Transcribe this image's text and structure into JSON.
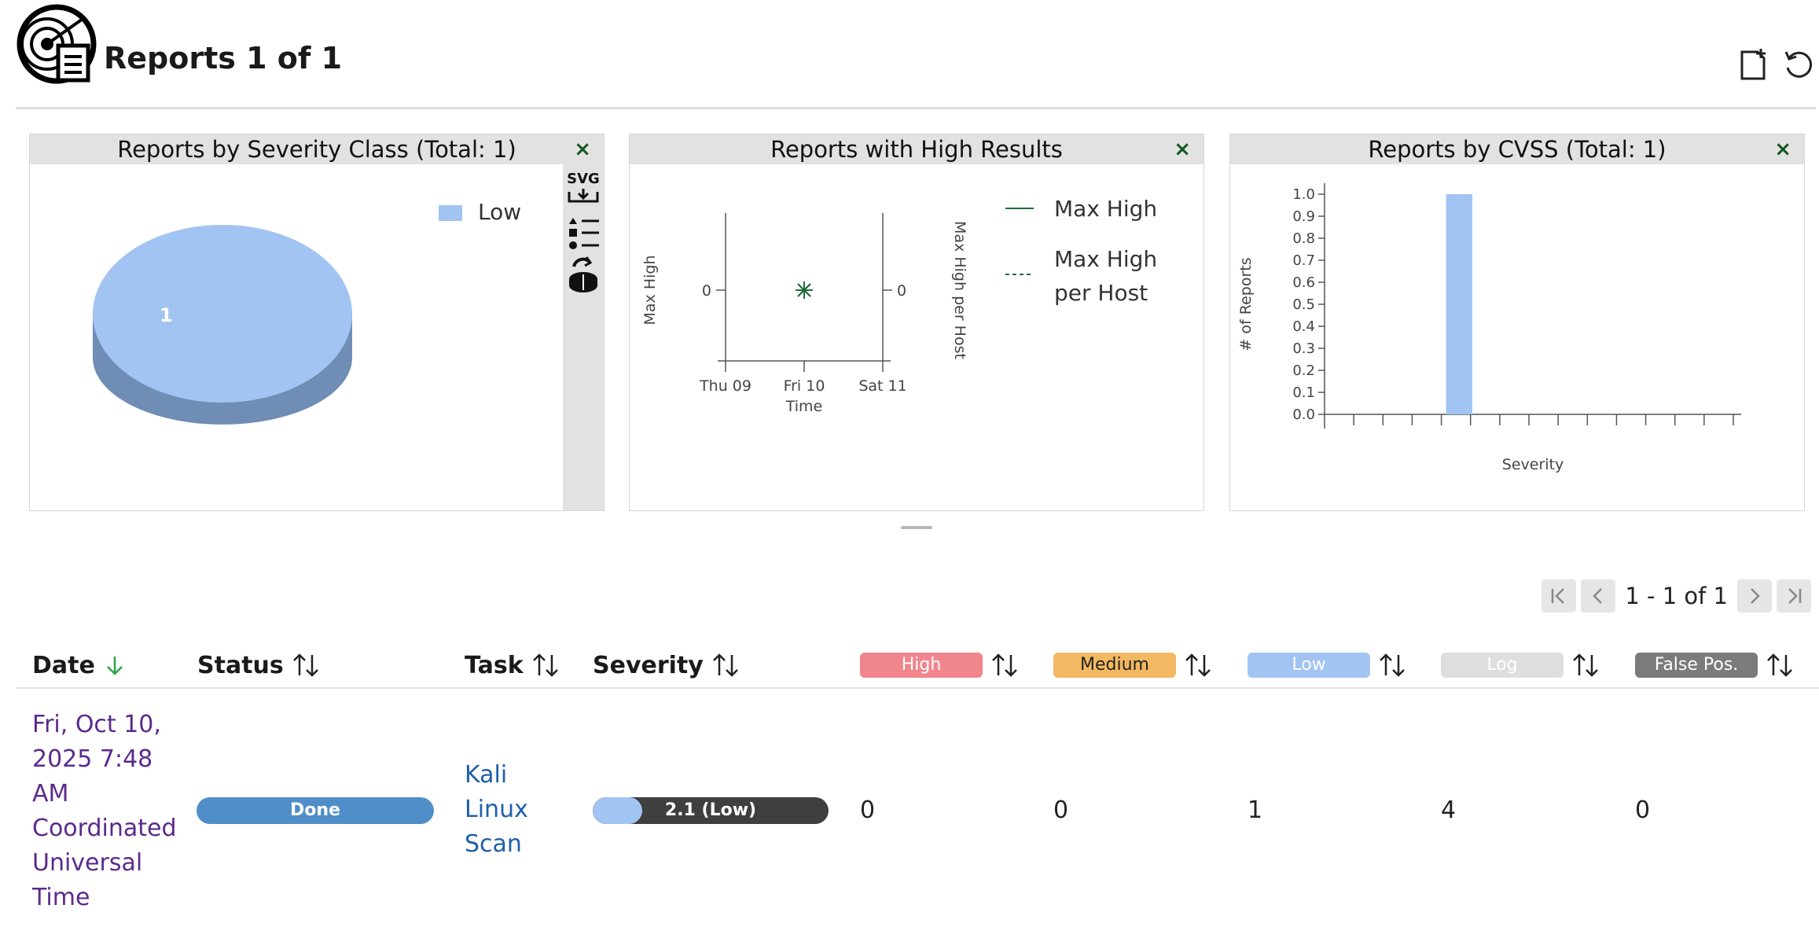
{
  "header": {
    "title": "Reports 1 of 1"
  },
  "panels": {
    "severity_class": {
      "title": "Reports by Severity Class (Total: 1)",
      "close": "×",
      "legend_label": "Low",
      "slice_label": "1",
      "toolbar_svg_label": "SVG"
    },
    "high_results": {
      "title": "Reports with High Results",
      "close": "×",
      "legend_max_high": "Max High",
      "legend_max_per_host_1": "Max High",
      "legend_max_per_host_2": "per Host"
    },
    "cvss": {
      "title": "Reports by CVSS (Total: 1)",
      "close": "×"
    }
  },
  "chart_data": [
    {
      "type": "pie",
      "title": "Reports by Severity Class (Total: 1)",
      "categories": [
        "Low"
      ],
      "values": [
        1
      ],
      "colors": [
        "#a2c4f2"
      ],
      "legend": "top-right"
    },
    {
      "type": "line",
      "title": "Reports with High Results",
      "x": [
        "Thu 09",
        "Fri 10",
        "Sat 11"
      ],
      "xlabel": "Time",
      "ylabel": "Max High",
      "y2label": "Max High per Host",
      "series": [
        {
          "name": "Max High",
          "points": [
            [
              "Fri 10",
              0
            ]
          ]
        },
        {
          "name": "Max High per Host",
          "points": [
            [
              "Fri 10",
              0
            ]
          ]
        }
      ],
      "yticks": [
        "0"
      ],
      "y2ticks": [
        "0"
      ],
      "color": "#1e6b3a"
    },
    {
      "type": "bar",
      "title": "Reports by CVSS (Total: 1)",
      "xlabel": "Severity",
      "ylabel": "# of Reports",
      "ylim": [
        0,
        1.0
      ],
      "yticks": [
        "0.0",
        "0.1",
        "0.2",
        "0.3",
        "0.4",
        "0.5",
        "0.6",
        "0.7",
        "0.8",
        "0.9",
        "1.0"
      ],
      "bins": 14,
      "values": [
        0,
        0,
        0,
        0,
        1,
        0,
        0,
        0,
        0,
        0,
        0,
        0,
        0,
        0
      ],
      "color": "#a2c4f2"
    }
  ],
  "pagination": {
    "text": "1 - 1 of 1"
  },
  "table": {
    "headers": {
      "date": "Date",
      "status": "Status",
      "task": "Task",
      "severity": "Severity",
      "high": "High",
      "medium": "Medium",
      "low": "Low",
      "log": "Log",
      "false_pos": "False Pos."
    },
    "colors": {
      "high": "#f0868c",
      "medium": "#f3b862",
      "low": "#a2c4f2",
      "log": "#dedede",
      "false_pos": "#7b7b7b"
    },
    "rows": [
      {
        "date_lines": [
          "Fri, Oct 10,",
          "2025 7:48",
          "AM",
          "Coordinated",
          "Universal",
          "Time"
        ],
        "status": "Done",
        "task_lines": [
          "Kali",
          "Linux",
          "Scan"
        ],
        "severity_label": "2.1 (Low)",
        "severity_score": 2.1,
        "high": "0",
        "medium": "0",
        "low": "1",
        "log": "4",
        "false_pos": "0"
      }
    ]
  }
}
